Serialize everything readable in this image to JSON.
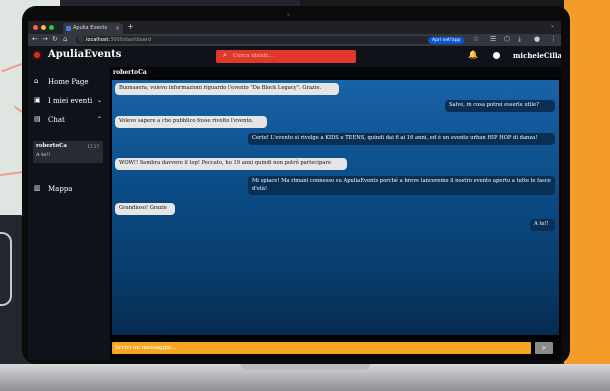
{
  "browser": {
    "tab_title": "Apulia Events",
    "url_host": "localhost",
    "url_path": ":3000/dashboard",
    "open_app_button": "Apri nell'app"
  },
  "header": {
    "brand": "ApuliaEvents",
    "search_placeholder": "Cerca utenti...",
    "username": "micheleCilla"
  },
  "sidebar": {
    "items": [
      {
        "label": "Home Page",
        "icon": "home-icon"
      },
      {
        "label": "I miei eventi",
        "icon": "calendar-icon",
        "chevron": "⌄"
      },
      {
        "label": "Chat",
        "icon": "chat-icon",
        "chevron": "⌃"
      },
      {
        "label": "Mappa",
        "icon": "map-icon"
      }
    ],
    "conversation": {
      "name": "robertoCa",
      "time": "17:17",
      "last_message": "A te!!"
    }
  },
  "chat": {
    "contact": "robertoCa",
    "messages": [
      {
        "side": "in",
        "text": "Buonasera, volevo informazioni riguardo l'evento \"Da Block Legacy\". Grazie."
      },
      {
        "side": "out",
        "text": "Salve, in cosa potrei esserle utile?"
      },
      {
        "side": "in",
        "text": "Volevo sapere a che pubblico fosse rivolto l'evento."
      },
      {
        "side": "out",
        "text": "Certo! L'evento si rivolge a KIDS e TEENS, quindi dai 6 ai 16 anni, ed è un evento urban HIP HOP di danza!"
      },
      {
        "side": "in",
        "text": "WOW!! Sembra davvero il top! Peccato, ho 19 anni quindi non potrò partecipare"
      },
      {
        "side": "out",
        "text": "Mi spiace! Ma rimani connesso su ApuliaEvents perché a breve lanceremo il nostro evento aperto a tutte le fasce d'età!"
      },
      {
        "side": "in",
        "text": "Grandioso! Grazie"
      },
      {
        "side": "out",
        "text": "A te!!"
      }
    ],
    "input_placeholder": "Scrivi un messaggio...",
    "send_icon": "send-icon"
  },
  "colors": {
    "accent_orange": "#f5a623",
    "search_red": "#e0392c",
    "bubble_out": "#0a2f55",
    "bubble_in": "#e5e5e5"
  }
}
